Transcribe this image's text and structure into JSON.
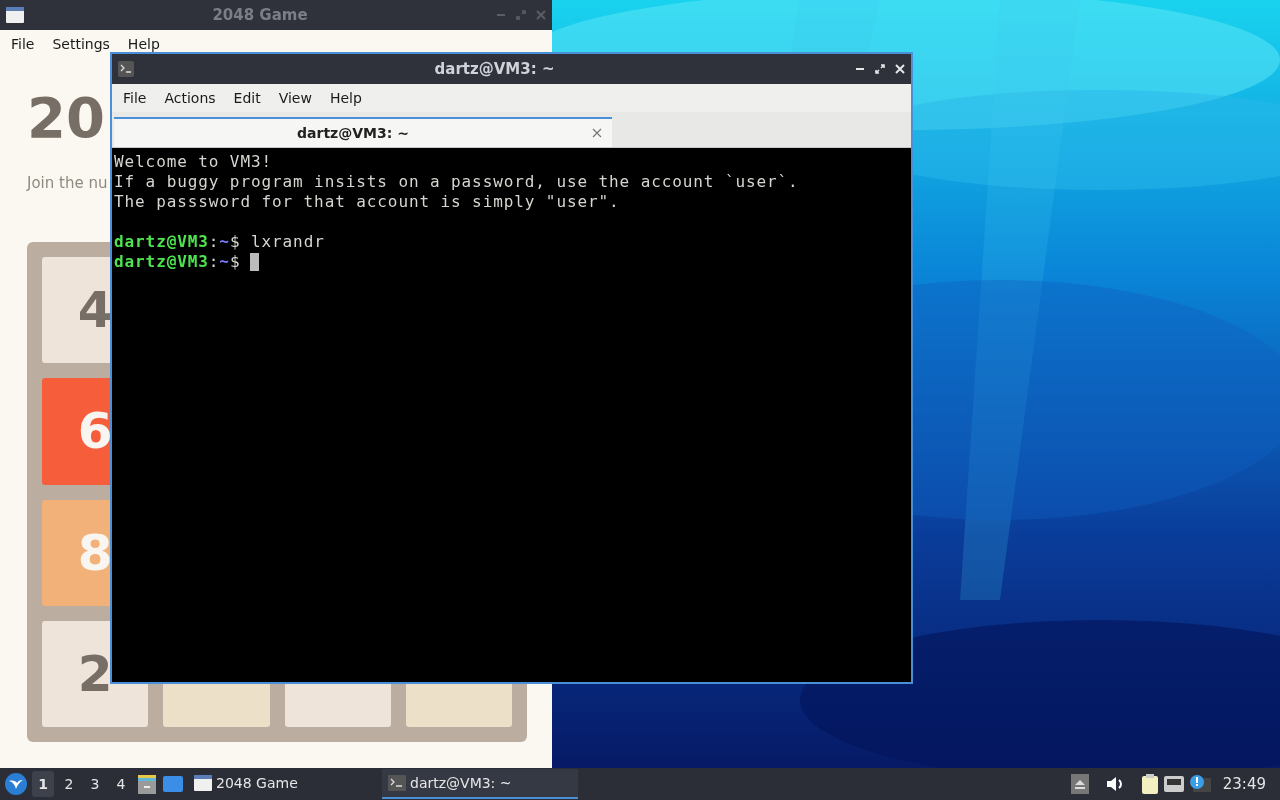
{
  "game_window": {
    "title": "2048 Game",
    "menu": [
      "File",
      "Settings",
      "Help"
    ],
    "heading": "20",
    "intro": "Join the nu",
    "board": [
      [
        {
          "value": "4",
          "color": "#eee4da"
        }
      ],
      [
        {
          "value": "6",
          "color": "#f65e3b"
        }
      ],
      [
        {
          "value": "8",
          "color": "#f2b179"
        }
      ],
      [
        {
          "value": "2",
          "color": "#eee4da"
        },
        {
          "color": "#ede0c8"
        },
        {
          "color": "#eee4da"
        },
        {
          "color": "#ede0c8"
        }
      ]
    ]
  },
  "terminal_window": {
    "title": "dartz@VM3: ~",
    "menu": [
      "File",
      "Actions",
      "Edit",
      "View",
      "Help"
    ],
    "tabs": [
      {
        "label": "dartz@VM3: ~",
        "selected": true
      }
    ],
    "lines": [
      {
        "kind": "text",
        "text": "Welcome to VM3!"
      },
      {
        "kind": "text",
        "text": "If a buggy program insists on a password, use the account `user`."
      },
      {
        "kind": "text",
        "text": "The passsword for that account is simply \"user\"."
      },
      {
        "kind": "blank"
      },
      {
        "kind": "prompt",
        "host": "dartz@VM3",
        "sep": ":",
        "path": "~",
        "end": "$",
        "command": "lxrandr"
      },
      {
        "kind": "prompt",
        "host": "dartz@VM3",
        "sep": ":",
        "path": "~",
        "end": "$",
        "cursor": true
      }
    ]
  },
  "taskbar": {
    "workspaces": [
      {
        "label": "1",
        "selected": true
      },
      {
        "label": "2",
        "selected": false
      },
      {
        "label": "3",
        "selected": false
      },
      {
        "label": "4",
        "selected": false
      }
    ],
    "tasks": [
      {
        "kind": "window",
        "label": "2048 Game",
        "selected": false
      },
      {
        "kind": "terminal",
        "label": "dartz@VM3: ~",
        "selected": true
      }
    ],
    "clock": "23:49"
  }
}
